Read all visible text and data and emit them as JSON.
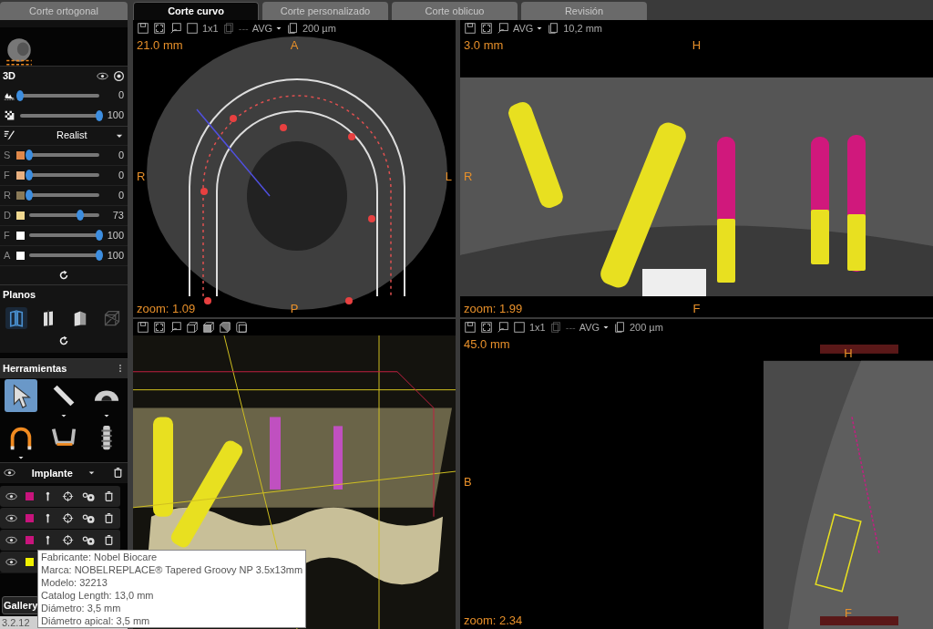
{
  "tabs": [
    {
      "label": "Corte ortogonal",
      "selected": false
    },
    {
      "label": "Corte curvo",
      "selected": true
    },
    {
      "label": "Corte personalizado",
      "selected": false
    },
    {
      "label": "Corte oblicuo",
      "selected": false
    },
    {
      "label": "Revisión",
      "selected": false
    }
  ],
  "panel_3d": {
    "title": "3D",
    "sliders": [
      {
        "kind": "histogram",
        "level": 0,
        "reading": "0"
      },
      {
        "kind": "opacity",
        "level": 1,
        "reading": "100"
      }
    ],
    "preset": "Realist",
    "channels": [
      {
        "letter": "S",
        "color": "#e0884a",
        "level": 0,
        "reading": "0"
      },
      {
        "letter": "F",
        "color": "#e8b080",
        "level": 0,
        "reading": "0"
      },
      {
        "letter": "R",
        "color": "#8a7a58",
        "level": 0,
        "reading": "0"
      },
      {
        "letter": "D",
        "color": "#f0d890",
        "level": 0.73,
        "reading": "73"
      },
      {
        "letter": "F",
        "color": "#ffffff",
        "level": 1,
        "reading": "100"
      },
      {
        "letter": "A",
        "color": "#ffffff",
        "level": 1,
        "reading": "100"
      }
    ]
  },
  "planes": {
    "title": "Planos",
    "items": [
      {
        "kind": "split",
        "selected": true
      },
      {
        "kind": "half",
        "selected": false
      },
      {
        "kind": "fold",
        "selected": false
      },
      {
        "kind": "cube",
        "selected": false
      }
    ]
  },
  "tools": {
    "title": "Herramientas",
    "items": [
      {
        "kind": "pointer",
        "selected": true,
        "menu": false
      },
      {
        "kind": "ruler",
        "selected": false,
        "menu": true
      },
      {
        "kind": "protractor",
        "selected": false,
        "menu": true
      },
      {
        "kind": "arch",
        "selected": false,
        "menu": true
      },
      {
        "kind": "jaw",
        "selected": false,
        "menu": false
      },
      {
        "kind": "implant",
        "selected": false,
        "menu": false
      }
    ]
  },
  "objects": {
    "type": "Implante",
    "rows": [
      {
        "color": "#c8147c"
      },
      {
        "color": "#c8147c"
      },
      {
        "color": "#c8147c"
      },
      {
        "color": "#f0f000"
      }
    ]
  },
  "gallery_button": "Gallery",
  "version": "3.2.12",
  "viewports": [
    {
      "kind": "axial",
      "toolbar": [
        {
          "kind": "save"
        },
        {
          "kind": "fit"
        },
        {
          "kind": "snapshot"
        },
        {
          "kind": "frame"
        },
        {
          "kind": "text",
          "text": "1x1"
        },
        {
          "kind": "stack"
        },
        {
          "kind": "dim",
          "text": "---"
        },
        {
          "kind": "dropdown",
          "text": "AVG"
        },
        {
          "kind": "page"
        },
        {
          "kind": "text",
          "text": "200 µm"
        }
      ],
      "labels": {
        "depth": "21.0 mm",
        "top": "A",
        "left": "R",
        "right": "L",
        "zoom": "zoom: 1.09",
        "bottom": "P"
      }
    },
    {
      "kind": "panoramic",
      "toolbar": [
        {
          "kind": "save"
        },
        {
          "kind": "fit"
        },
        {
          "kind": "snapshot"
        },
        {
          "kind": "dropdown",
          "text": "AVG"
        },
        {
          "kind": "page"
        },
        {
          "kind": "text",
          "text": "10,2 mm"
        }
      ],
      "labels": {
        "depth": "3.0 mm",
        "top": "H",
        "left": "R",
        "zoom": "zoom: 1.99",
        "bottom": "F"
      }
    },
    {
      "kind": "render3d",
      "toolbar": [
        {
          "kind": "save"
        },
        {
          "kind": "fit"
        },
        {
          "kind": "snapshot"
        },
        {
          "kind": "cube-front"
        },
        {
          "kind": "cube-solid"
        },
        {
          "kind": "cube-side"
        },
        {
          "kind": "cube-top"
        }
      ]
    },
    {
      "kind": "cross_section",
      "toolbar": [
        {
          "kind": "save"
        },
        {
          "kind": "fit"
        },
        {
          "kind": "snapshot"
        },
        {
          "kind": "frame"
        },
        {
          "kind": "text",
          "text": "1x1"
        },
        {
          "kind": "stack"
        },
        {
          "kind": "dim",
          "text": "---"
        },
        {
          "kind": "dropdown",
          "text": "AVG"
        },
        {
          "kind": "page"
        },
        {
          "kind": "text",
          "text": "200 µm"
        }
      ],
      "labels": {
        "depth": "45.0 mm",
        "left": "B",
        "zoom": "zoom: 2.34"
      },
      "inset_labels": {
        "top": "H",
        "bottom": "F"
      }
    }
  ],
  "tooltip": {
    "lines": [
      "Fabricante: Nobel Biocare",
      "Marca: NOBELREPLACE® Tapered Groovy NP 3.5x13mm",
      "Modelo: 32213",
      "Catalog Length: 13,0 mm",
      "Diámetro: 3,5 mm",
      "Diámetro apical: 3,5 mm"
    ]
  }
}
